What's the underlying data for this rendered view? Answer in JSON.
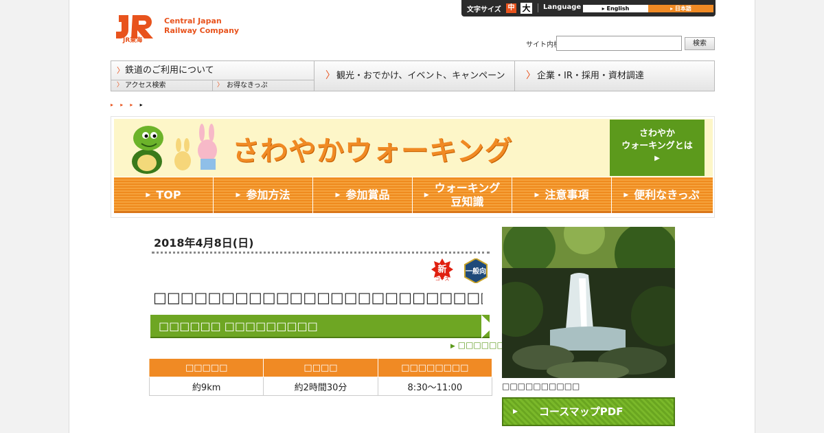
{
  "header": {
    "logo_jr": "JR",
    "logo_sub": "JR東海",
    "company_line1": "Central Japan",
    "company_line2": "Railway Company"
  },
  "util": {
    "font_size_label": "文字サイズ",
    "font_mid": "中",
    "font_big": "大",
    "language_label": "Language",
    "lang_en": "English",
    "lang_ja": "日本語"
  },
  "search": {
    "label": "サイト内検索",
    "placeholder": "",
    "button": "検索"
  },
  "nav": {
    "rail": "鉄道のご利用について",
    "access": "アクセス検索",
    "tickets": "お得なきっぷ",
    "sightseeing": "観光・おでかけ、イベント、キャンペーン",
    "corporate": "企業・IR・採用・資材調達"
  },
  "banner": {
    "title": "さわやかウォーキング",
    "about_line1": "さわやか",
    "about_line2": "ウォーキングとは",
    "tabs": [
      "TOP",
      "参加方法",
      "参加賞品",
      "ウォーキング\n豆知識",
      "注意事項",
      "便利なきっぷ"
    ]
  },
  "event": {
    "date": "2018年4月8日(日)",
    "badge_new": "新",
    "badge_new_sub": "コース",
    "badge_general": "一般向",
    "title": "□□□□□□□□□□□□□□□□□□□□□□□□□□□□□□□□□□□□",
    "station": "□□□□□□ □□□□□□□□□",
    "more_link": "□□□□□□□□",
    "table_headers": [
      "□□□□□",
      "□□□□",
      "□□□□□□□□"
    ],
    "table_values": [
      "約9km",
      "約2時間30分",
      "8:30～11:00"
    ],
    "photo_caption": "□□□□□□□□□□",
    "map_button": "コースマップPDF"
  },
  "colors": {
    "brand_orange": "#e8531d",
    "tab_orange": "#f08a24",
    "green": "#5c9a1c"
  }
}
